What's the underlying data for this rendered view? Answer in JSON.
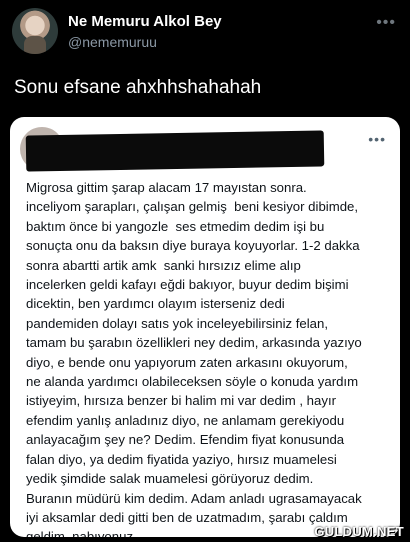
{
  "header": {
    "display_name": "Ne Memuru Alkol Bey",
    "handle": "@nememuruu",
    "more_label": "•••"
  },
  "tweet": {
    "text": "Sonu efsane ahxhhshahahah"
  },
  "embedded": {
    "more_label": "•••",
    "text": "Migrosa gittim şarap alacam 17 mayıstan sonra.\ninceliyom şarapları, çalışan gelmiş  beni kesiyor dibimde,\nbaktım önce bi yangozle  ses etmedim dedim işi bu\nsonuçta onu da baksın diye buraya koyuyorlar. 1-2 dakka\nsonra abartti artik amk  sanki hırsızız elime alıp\nincelerken geldi kafayı eğdi bakıyor, buyur dedim bişimi\ndicektin, ben yardımcı olayım isterseniz dedi\npandemiden dolayı satıs yok inceleyebilirsiniz felan,\ntamam bu şarabın özellikleri ney dedim, arkasında yazıyo\ndiyo, e bende onu yapıyorum zaten arkasını okuyorum,\nne alanda yardımcı olabileceksen söyle o konuda yardım\nistiyeyim, hırsıza benzer bi halim mi var dedim , hayır\nefendim yanlış anladınız diyo, ne anlamam gerekiyodu\nanlayacağım şey ne? Dedim. Efendim fiyat konusunda\nfalan diyo, ya dedim fiyatida yaziyo, hırsız muamelesi\nyedik şimdide salak muamelesi görüyoruz dedim.\nBuranın müdürü kim dedim. Adam anladı ugrasamayacak\niyi aksamlar dedi gitti ben de uzatmadım, şarabı çaldım\ngeldim. nabıyonuz"
  },
  "watermark": "GULDUM.NET"
}
